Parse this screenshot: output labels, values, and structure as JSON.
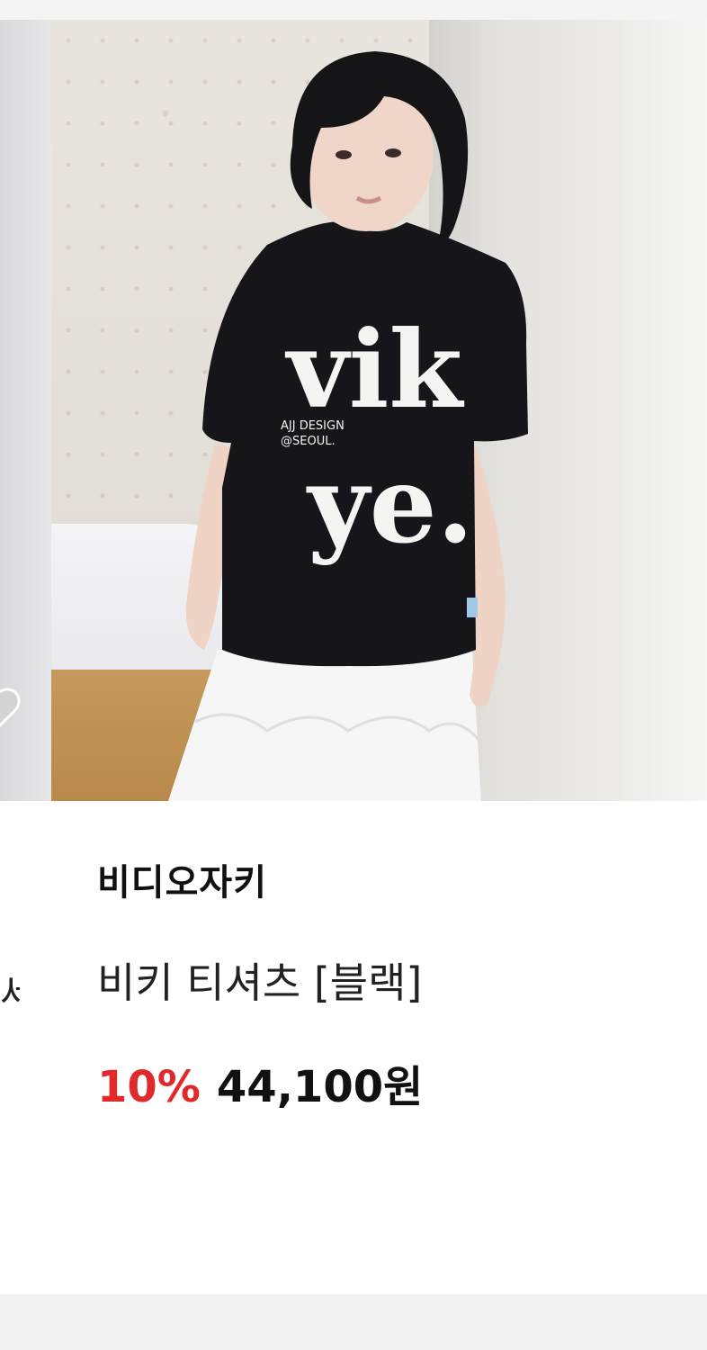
{
  "product": {
    "brand": "비디오자키",
    "name": "비키 티셔츠 [블랙]",
    "discount": "10%",
    "price": "44,100원",
    "shirt_print_large": "vikye.",
    "shirt_print_small_line1": "AJJ DESIGN",
    "shirt_print_small_line2": "@SEOUL."
  },
  "neighbor_left": {
    "name_fragment": "세"
  },
  "colors": {
    "discount": "#e0292b",
    "heart": "#d3d3d3",
    "shirt": "#16161a"
  },
  "icons": {
    "wishlist": "heart-icon"
  }
}
